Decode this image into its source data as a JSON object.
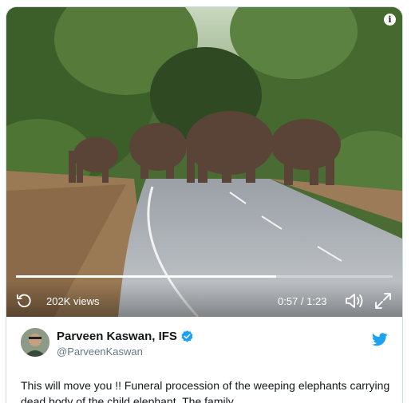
{
  "video": {
    "views": "202K views",
    "time": "0:57 / 1:23",
    "progress_fraction": 0.69,
    "info_glyph": "i"
  },
  "tweet": {
    "display_name": "Parveen Kaswan, IFS",
    "handle": "@ParveenKaswan",
    "text": "This will move you !! Funeral procession of the weeping elephants carrying dead body of the child elephant. The family"
  },
  "icons": {
    "replay": "replay-icon",
    "volume": "volume-icon",
    "fullscreen": "fullscreen-icon",
    "verified": "verified-badge-icon",
    "twitter": "twitter-bird-icon",
    "info": "info-icon"
  },
  "colors": {
    "twitter_blue": "#1da1f2",
    "text_primary": "#14171a",
    "text_secondary": "#657786"
  }
}
